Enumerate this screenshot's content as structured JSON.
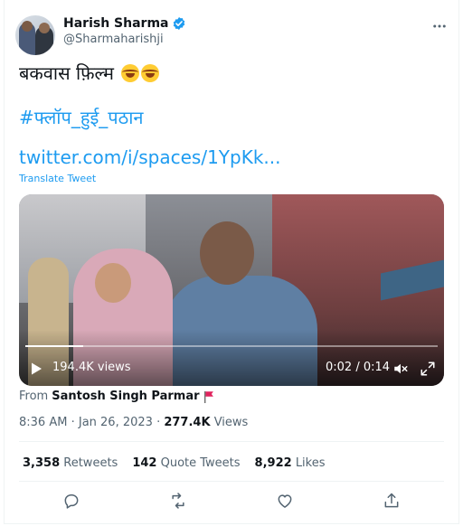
{
  "author": {
    "display_name": "Harish Sharma",
    "handle": "@Sharmaharishji"
  },
  "tweet": {
    "text": "बकवास फ़िल्म",
    "hashtag": "#फ्लॉप_हुई_पठान",
    "link": "twitter.com/i/spaces/1YpKk...",
    "translate_label": "Translate Tweet"
  },
  "video": {
    "views": "194.4K views",
    "time": "0:02 / 0:14",
    "progress": 0.14
  },
  "source": {
    "prefix": "From",
    "name": "Santosh Singh Parmar"
  },
  "meta": {
    "time": "8:36 AM",
    "separator": "·",
    "date": "Jan 26, 2023",
    "views_count": "277.4K",
    "views_label": "Views"
  },
  "stats": {
    "retweets_count": "3,358",
    "retweets_label": "Retweets",
    "quotes_count": "142",
    "quotes_label": "Quote Tweets",
    "likes_count": "8,922",
    "likes_label": "Likes"
  },
  "icons": {
    "verified": "verified-badge-icon",
    "more": "more-options-icon",
    "reply": "reply-icon",
    "retweet": "retweet-icon",
    "like": "like-icon",
    "share": "share-icon"
  },
  "colors": {
    "accent": "#1d9bf0",
    "secondary_text": "#536471",
    "primary_text": "#0f1419"
  }
}
